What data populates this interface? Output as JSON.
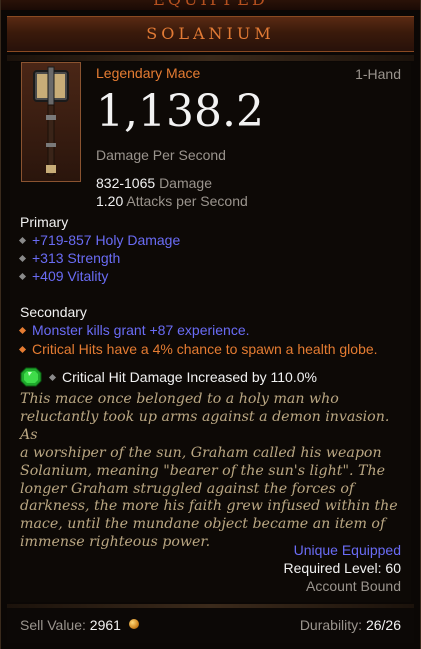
{
  "header": {
    "equipped_label": "EQUIPPED",
    "item_name": "SOLANIUM"
  },
  "item": {
    "icon": "mace-icon",
    "type": "Legendary Mace",
    "slot": "1-Hand",
    "dps": "1,138.2",
    "dps_label": "Damage Per Second",
    "damage_value": "832-1065",
    "damage_label": "Damage",
    "aps_value": "1.20",
    "aps_label": "Attacks per Second"
  },
  "primary": {
    "heading": "Primary",
    "stats": [
      "+719-857 Holy Damage",
      "+313 Strength",
      "+409 Vitality"
    ]
  },
  "secondary": {
    "heading": "Secondary",
    "stats": [
      "Monster kills grant +87 experience.",
      "Critical Hits have a 4% chance to spawn a health globe."
    ]
  },
  "gem": {
    "icon": "emerald-gem-icon",
    "text": "Critical Hit Damage Increased by 110.0%"
  },
  "flavor_lines": [
    "This mace once belonged to a holy man who",
    "reluctantly took up arms against a demon invasion. As",
    "a worshiper of the sun, Graham called his weapon",
    "Solanium, meaning \"bearer of the sun's light\". The",
    "longer Graham struggled against the forces of",
    "darkness, the more his faith grew infused within the",
    "mace, until the mundane object became an item of",
    "immense righteous power."
  ],
  "status": {
    "unique": "Unique Equipped",
    "required_level": "Required Level: 60",
    "bound": "Account Bound"
  },
  "footer": {
    "sell_label": "Sell Value:",
    "sell_value": "2961",
    "durability_label": "Durability:",
    "durability_value": "26/26"
  },
  "colors": {
    "legendary_orange": "#e57c32",
    "magic_blue": "#6a6cf5",
    "flavor_tan": "#b9a682"
  }
}
